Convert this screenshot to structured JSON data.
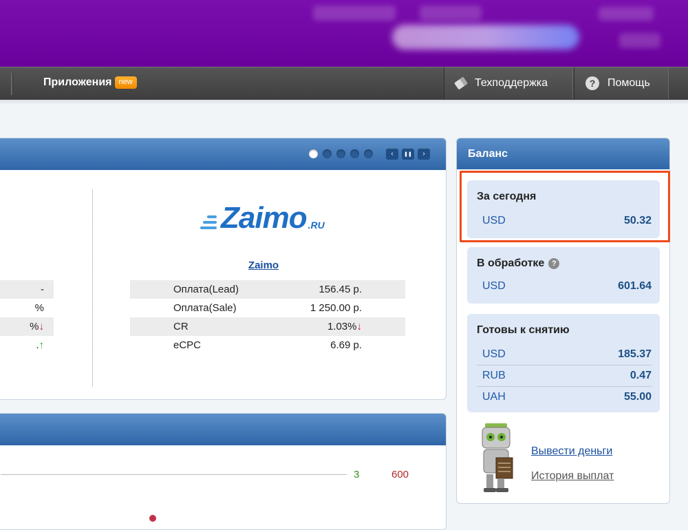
{
  "nav": {
    "apps_label": "Приложения",
    "apps_badge": "new",
    "support_label": "Техподдержка",
    "help_label": "Помощь"
  },
  "carousel": {
    "dots": 5,
    "active_index": 0,
    "prev_symbol": "‹",
    "pause_symbol": "❚❚",
    "next_symbol": "›"
  },
  "offer": {
    "logo_text": "Zaimo",
    "logo_tld": ".RU",
    "name": "Zaimo",
    "stats": [
      {
        "label": "Оплата(Lead)",
        "value": "156.45 р."
      },
      {
        "label": "Оплата(Sale)",
        "value": "1 250.00 р."
      },
      {
        "label": "CR",
        "value": "1.03%",
        "trend": "↓"
      },
      {
        "label": "eCPC",
        "value": "6.69 р."
      }
    ]
  },
  "offer_left_partial": {
    "values": [
      "-",
      "%",
      "%",
      "."
    ],
    "trends": [
      "",
      "",
      "↓",
      "↑"
    ]
  },
  "panel2": {
    "value_green": "3",
    "value_red": "600"
  },
  "balance": {
    "title": "Баланс",
    "today": {
      "title": "За сегодня",
      "rows": [
        {
          "currency": "USD",
          "amount": "50.32"
        }
      ]
    },
    "processing": {
      "title": "В обработке",
      "help_icon": "?",
      "rows": [
        {
          "currency": "USD",
          "amount": "601.64"
        }
      ]
    },
    "ready": {
      "title": "Готовы к снятию",
      "rows": [
        {
          "currency": "USD",
          "amount": "185.37"
        },
        {
          "currency": "RUB",
          "amount": "0.47"
        },
        {
          "currency": "UAH",
          "amount": "55.00"
        }
      ]
    },
    "withdraw_link": "Вывести деньги",
    "history_link": "История выплат"
  },
  "colors": {
    "banner": "#7a0fae",
    "header_blue": "#2f66a8",
    "highlight": "#ef4a1c",
    "amount_blue": "#1c4f86"
  }
}
